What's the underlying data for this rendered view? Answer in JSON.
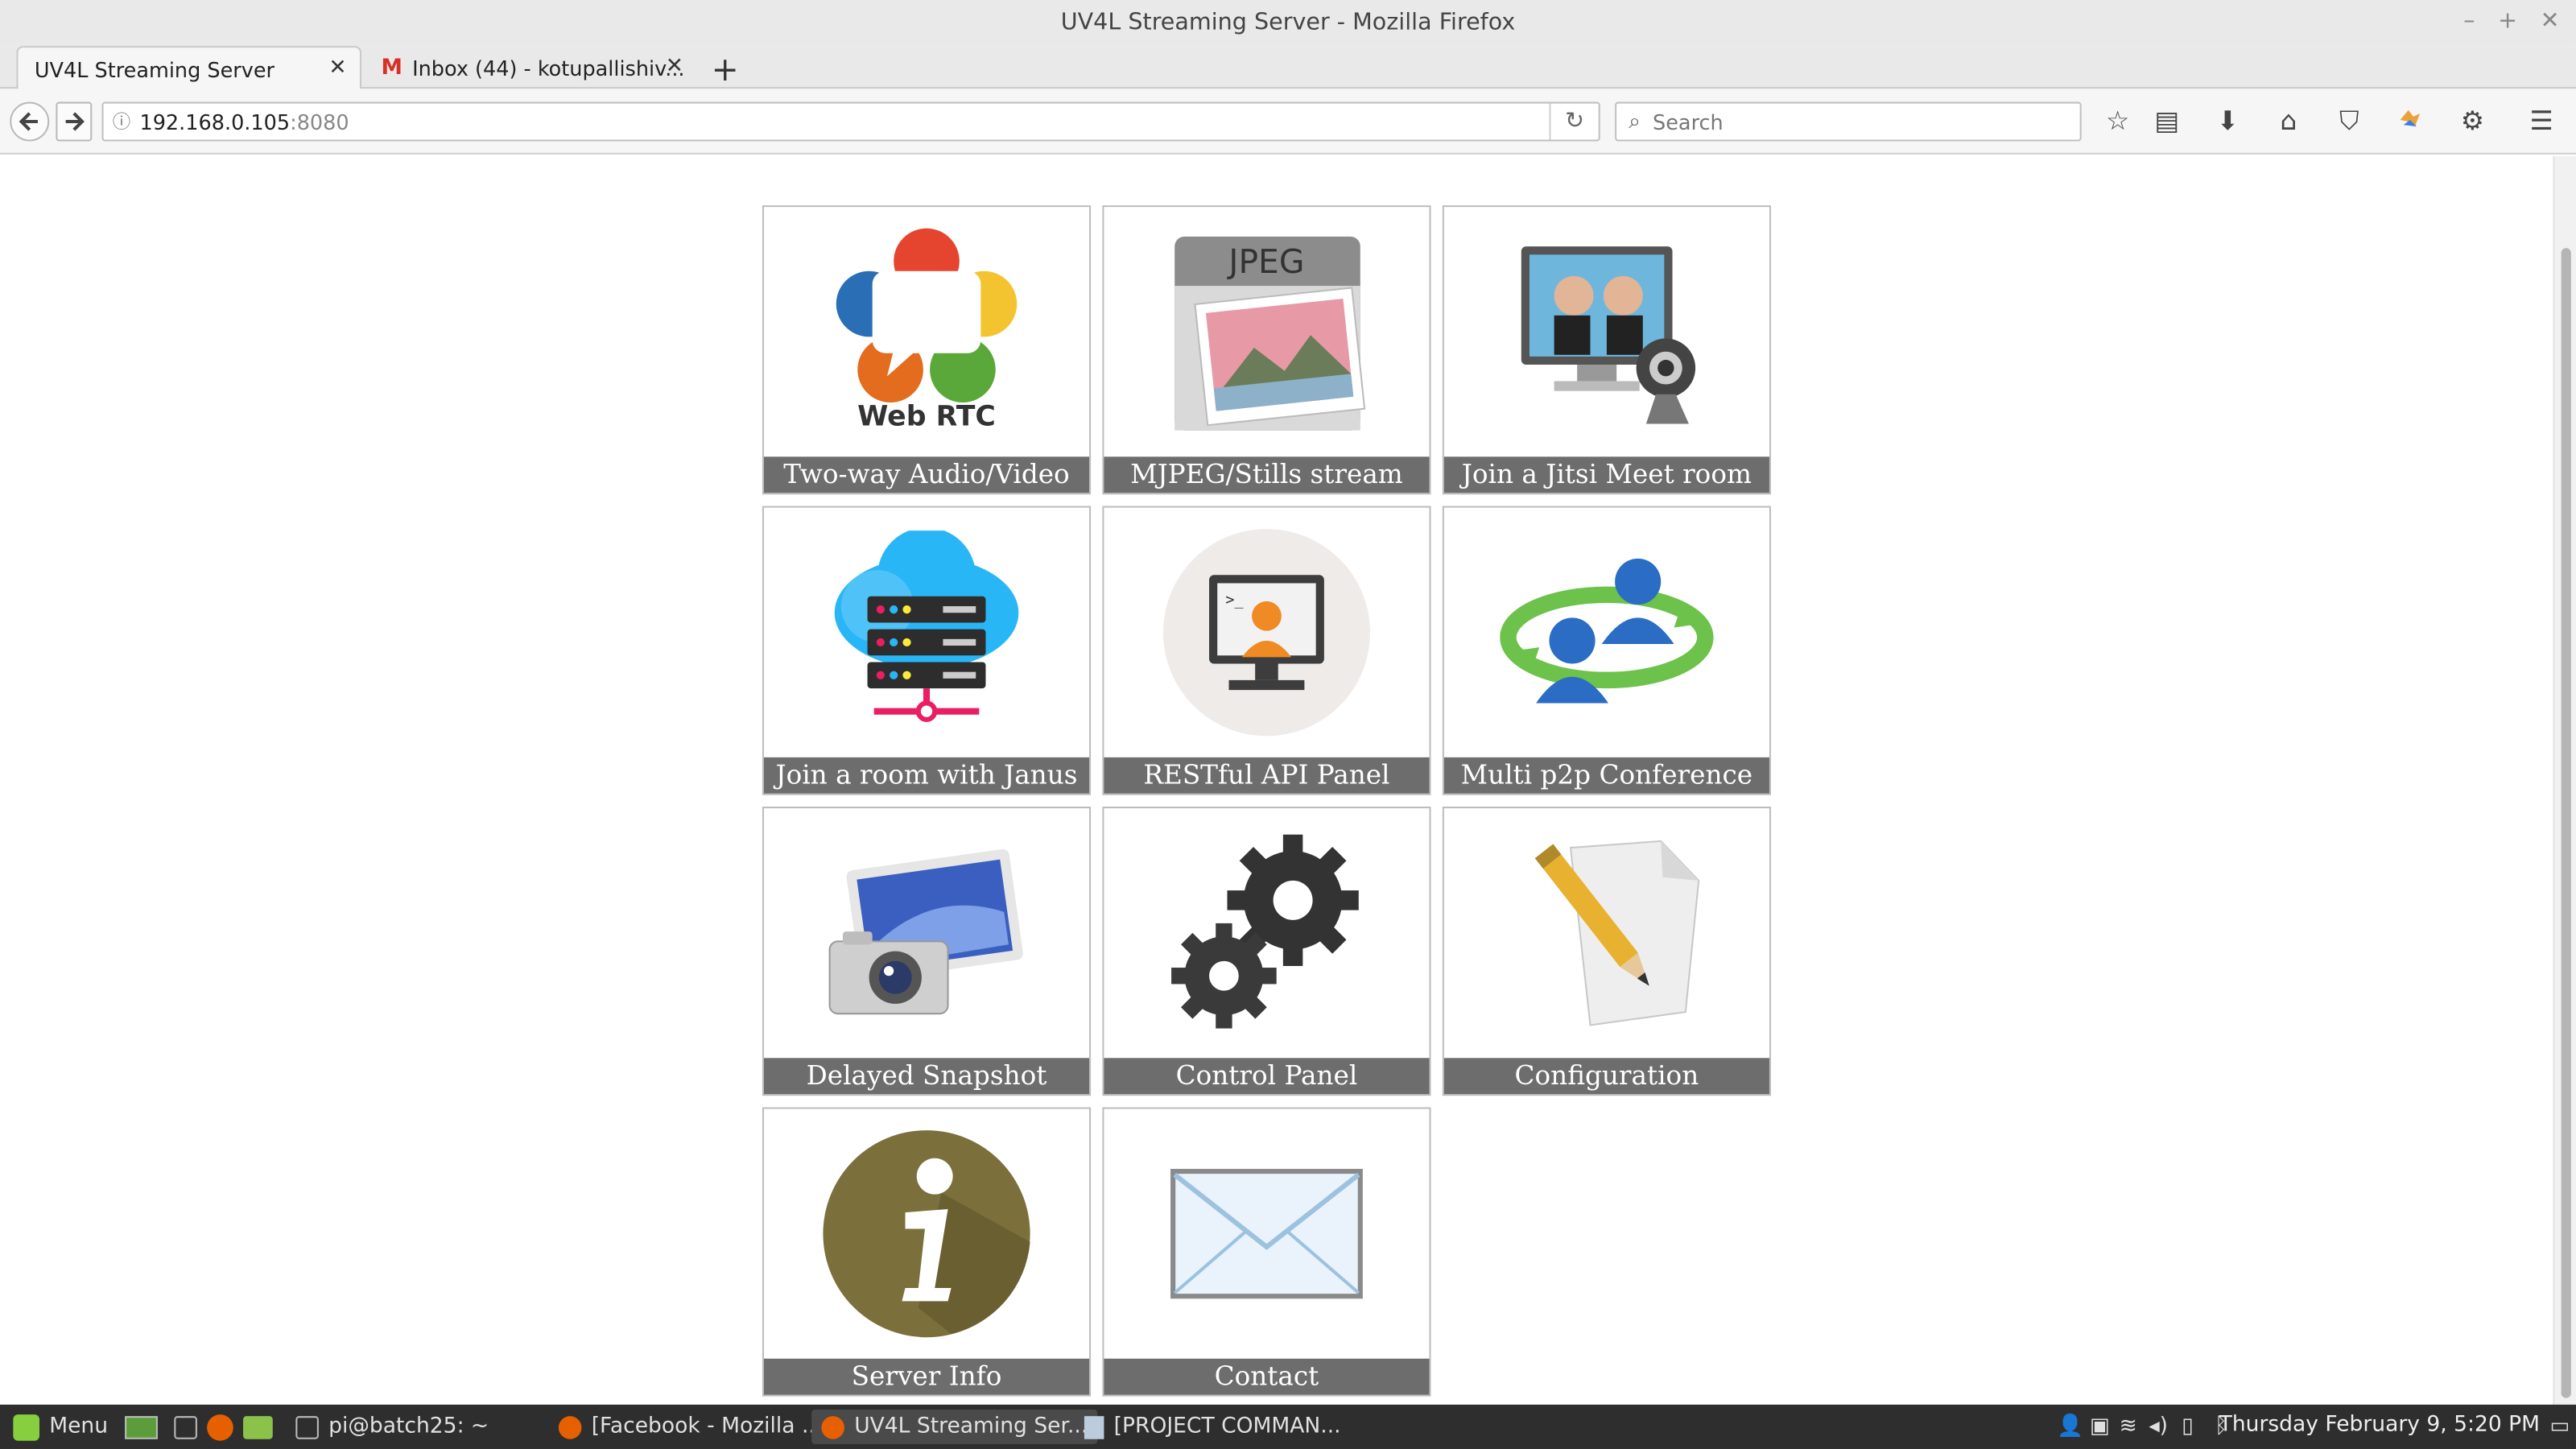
{
  "window": {
    "title": "UV4L Streaming Server - Mozilla Firefox"
  },
  "tabs": [
    {
      "label": "UV4L Streaming Server"
    },
    {
      "label": "Inbox (44) - kotupallishiv..."
    }
  ],
  "nav": {
    "url_host": "192.168.0.105",
    "url_port": ":8080",
    "search_placeholder": "Search"
  },
  "tiles": [
    {
      "label": "Two-way Audio/Video",
      "icon": "webrtc-icon"
    },
    {
      "label": "MJPEG/Stills stream",
      "icon": "jpeg-icon"
    },
    {
      "label": "Join a Jitsi Meet room",
      "icon": "jitsi-icon"
    },
    {
      "label": "Join a room with Janus",
      "icon": "janus-cloud-icon"
    },
    {
      "label": "RESTful API Panel",
      "icon": "api-terminal-icon"
    },
    {
      "label": "Multi p2p Conference",
      "icon": "conference-users-icon"
    },
    {
      "label": "Delayed Snapshot",
      "icon": "camera-snapshot-icon"
    },
    {
      "label": "Control Panel",
      "icon": "gears-icon"
    },
    {
      "label": "Configuration",
      "icon": "pencil-paper-icon"
    },
    {
      "label": "Server Info",
      "icon": "info-icon"
    },
    {
      "label": "Contact",
      "icon": "envelope-icon"
    }
  ],
  "webrtc_text": "Web RTC",
  "jpeg_text": "JPEG",
  "taskbar": {
    "menu": "Menu",
    "items": [
      {
        "label": "pi@batch25: ~"
      },
      {
        "label": "[Facebook - Mozilla ..."
      },
      {
        "label": "UV4L Streaming Ser..."
      },
      {
        "label": "[PROJECT COMMAN..."
      }
    ],
    "clock": "Thursday February  9,  5:20 PM"
  }
}
